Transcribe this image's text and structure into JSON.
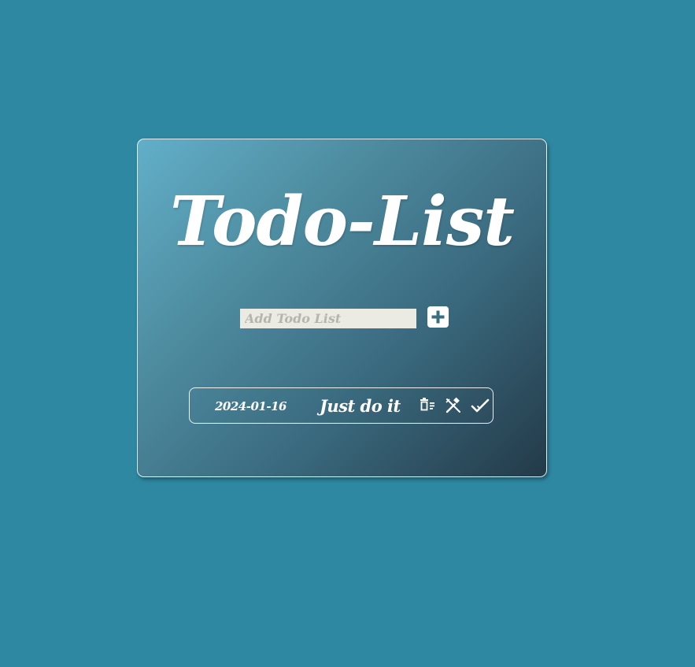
{
  "app": {
    "title": "Todo-List"
  },
  "add_form": {
    "placeholder": "Add Todo List",
    "value": "",
    "add_icon": "plus-icon"
  },
  "todos": [
    {
      "date": "2024-01-16",
      "text": "Just do it",
      "actions": {
        "delete_icon": "trash-icon",
        "edit_icon": "edit-icon",
        "done_icon": "check-icon"
      }
    }
  ],
  "colors": {
    "background": "#2e88a2",
    "card_gradient_start": "#62afc9",
    "card_gradient_end": "#233a48",
    "input_background": "#ebebe4",
    "text": "#ffffff"
  }
}
